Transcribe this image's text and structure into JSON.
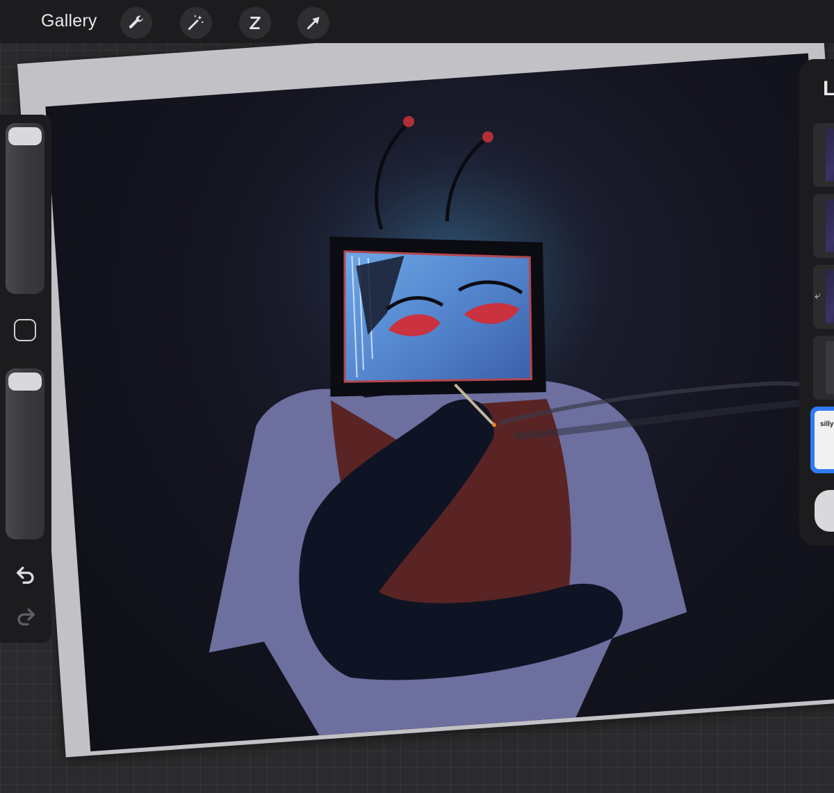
{
  "topbar": {
    "gallery_label": "Gallery",
    "tools": [
      "wrench-icon",
      "magic-wand-icon",
      "selection-icon",
      "transform-arrow-icon"
    ]
  },
  "sidebar": {
    "brush_size_slider": {
      "level": 0.97
    },
    "opacity_slider": {
      "level": 0.95
    },
    "icons": [
      "modify-square-icon",
      "undo-icon",
      "redo-icon"
    ]
  },
  "layers_panel": {
    "title": "L",
    "selected_layer_thumb_text": "silly"
  },
  "canvas": {
    "description_colors": {
      "background": "#14141f",
      "screen_glow": "#5b8fd0",
      "vest": "#6b2a24",
      "shirt": "#7d80b8"
    }
  }
}
